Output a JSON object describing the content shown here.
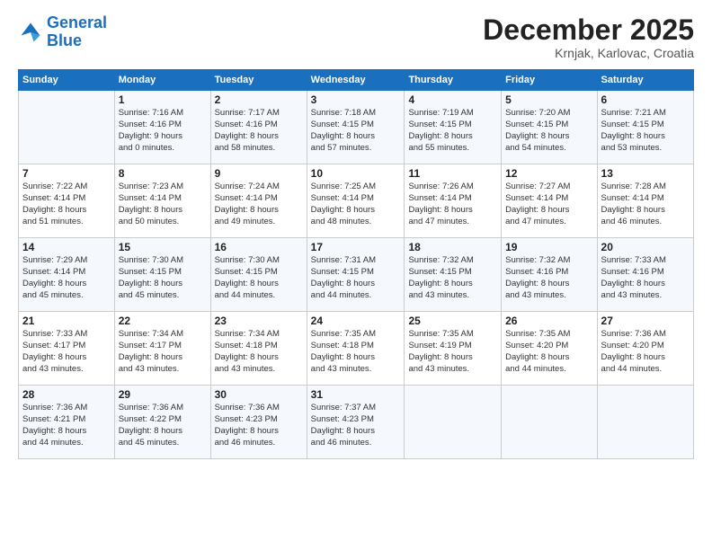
{
  "logo": {
    "text1": "General",
    "text2": "Blue"
  },
  "header": {
    "month_year": "December 2025",
    "location": "Krnjak, Karlovac, Croatia"
  },
  "weekdays": [
    "Sunday",
    "Monday",
    "Tuesday",
    "Wednesday",
    "Thursday",
    "Friday",
    "Saturday"
  ],
  "weeks": [
    [
      {
        "day": "",
        "info": ""
      },
      {
        "day": "1",
        "info": "Sunrise: 7:16 AM\nSunset: 4:16 PM\nDaylight: 9 hours\nand 0 minutes."
      },
      {
        "day": "2",
        "info": "Sunrise: 7:17 AM\nSunset: 4:16 PM\nDaylight: 8 hours\nand 58 minutes."
      },
      {
        "day": "3",
        "info": "Sunrise: 7:18 AM\nSunset: 4:15 PM\nDaylight: 8 hours\nand 57 minutes."
      },
      {
        "day": "4",
        "info": "Sunrise: 7:19 AM\nSunset: 4:15 PM\nDaylight: 8 hours\nand 55 minutes."
      },
      {
        "day": "5",
        "info": "Sunrise: 7:20 AM\nSunset: 4:15 PM\nDaylight: 8 hours\nand 54 minutes."
      },
      {
        "day": "6",
        "info": "Sunrise: 7:21 AM\nSunset: 4:15 PM\nDaylight: 8 hours\nand 53 minutes."
      }
    ],
    [
      {
        "day": "7",
        "info": "Sunrise: 7:22 AM\nSunset: 4:14 PM\nDaylight: 8 hours\nand 51 minutes."
      },
      {
        "day": "8",
        "info": "Sunrise: 7:23 AM\nSunset: 4:14 PM\nDaylight: 8 hours\nand 50 minutes."
      },
      {
        "day": "9",
        "info": "Sunrise: 7:24 AM\nSunset: 4:14 PM\nDaylight: 8 hours\nand 49 minutes."
      },
      {
        "day": "10",
        "info": "Sunrise: 7:25 AM\nSunset: 4:14 PM\nDaylight: 8 hours\nand 48 minutes."
      },
      {
        "day": "11",
        "info": "Sunrise: 7:26 AM\nSunset: 4:14 PM\nDaylight: 8 hours\nand 47 minutes."
      },
      {
        "day": "12",
        "info": "Sunrise: 7:27 AM\nSunset: 4:14 PM\nDaylight: 8 hours\nand 47 minutes."
      },
      {
        "day": "13",
        "info": "Sunrise: 7:28 AM\nSunset: 4:14 PM\nDaylight: 8 hours\nand 46 minutes."
      }
    ],
    [
      {
        "day": "14",
        "info": "Sunrise: 7:29 AM\nSunset: 4:14 PM\nDaylight: 8 hours\nand 45 minutes."
      },
      {
        "day": "15",
        "info": "Sunrise: 7:30 AM\nSunset: 4:15 PM\nDaylight: 8 hours\nand 45 minutes."
      },
      {
        "day": "16",
        "info": "Sunrise: 7:30 AM\nSunset: 4:15 PM\nDaylight: 8 hours\nand 44 minutes."
      },
      {
        "day": "17",
        "info": "Sunrise: 7:31 AM\nSunset: 4:15 PM\nDaylight: 8 hours\nand 44 minutes."
      },
      {
        "day": "18",
        "info": "Sunrise: 7:32 AM\nSunset: 4:15 PM\nDaylight: 8 hours\nand 43 minutes."
      },
      {
        "day": "19",
        "info": "Sunrise: 7:32 AM\nSunset: 4:16 PM\nDaylight: 8 hours\nand 43 minutes."
      },
      {
        "day": "20",
        "info": "Sunrise: 7:33 AM\nSunset: 4:16 PM\nDaylight: 8 hours\nand 43 minutes."
      }
    ],
    [
      {
        "day": "21",
        "info": "Sunrise: 7:33 AM\nSunset: 4:17 PM\nDaylight: 8 hours\nand 43 minutes."
      },
      {
        "day": "22",
        "info": "Sunrise: 7:34 AM\nSunset: 4:17 PM\nDaylight: 8 hours\nand 43 minutes."
      },
      {
        "day": "23",
        "info": "Sunrise: 7:34 AM\nSunset: 4:18 PM\nDaylight: 8 hours\nand 43 minutes."
      },
      {
        "day": "24",
        "info": "Sunrise: 7:35 AM\nSunset: 4:18 PM\nDaylight: 8 hours\nand 43 minutes."
      },
      {
        "day": "25",
        "info": "Sunrise: 7:35 AM\nSunset: 4:19 PM\nDaylight: 8 hours\nand 43 minutes."
      },
      {
        "day": "26",
        "info": "Sunrise: 7:35 AM\nSunset: 4:20 PM\nDaylight: 8 hours\nand 44 minutes."
      },
      {
        "day": "27",
        "info": "Sunrise: 7:36 AM\nSunset: 4:20 PM\nDaylight: 8 hours\nand 44 minutes."
      }
    ],
    [
      {
        "day": "28",
        "info": "Sunrise: 7:36 AM\nSunset: 4:21 PM\nDaylight: 8 hours\nand 44 minutes."
      },
      {
        "day": "29",
        "info": "Sunrise: 7:36 AM\nSunset: 4:22 PM\nDaylight: 8 hours\nand 45 minutes."
      },
      {
        "day": "30",
        "info": "Sunrise: 7:36 AM\nSunset: 4:23 PM\nDaylight: 8 hours\nand 46 minutes."
      },
      {
        "day": "31",
        "info": "Sunrise: 7:37 AM\nSunset: 4:23 PM\nDaylight: 8 hours\nand 46 minutes."
      },
      {
        "day": "",
        "info": ""
      },
      {
        "day": "",
        "info": ""
      },
      {
        "day": "",
        "info": ""
      }
    ]
  ]
}
